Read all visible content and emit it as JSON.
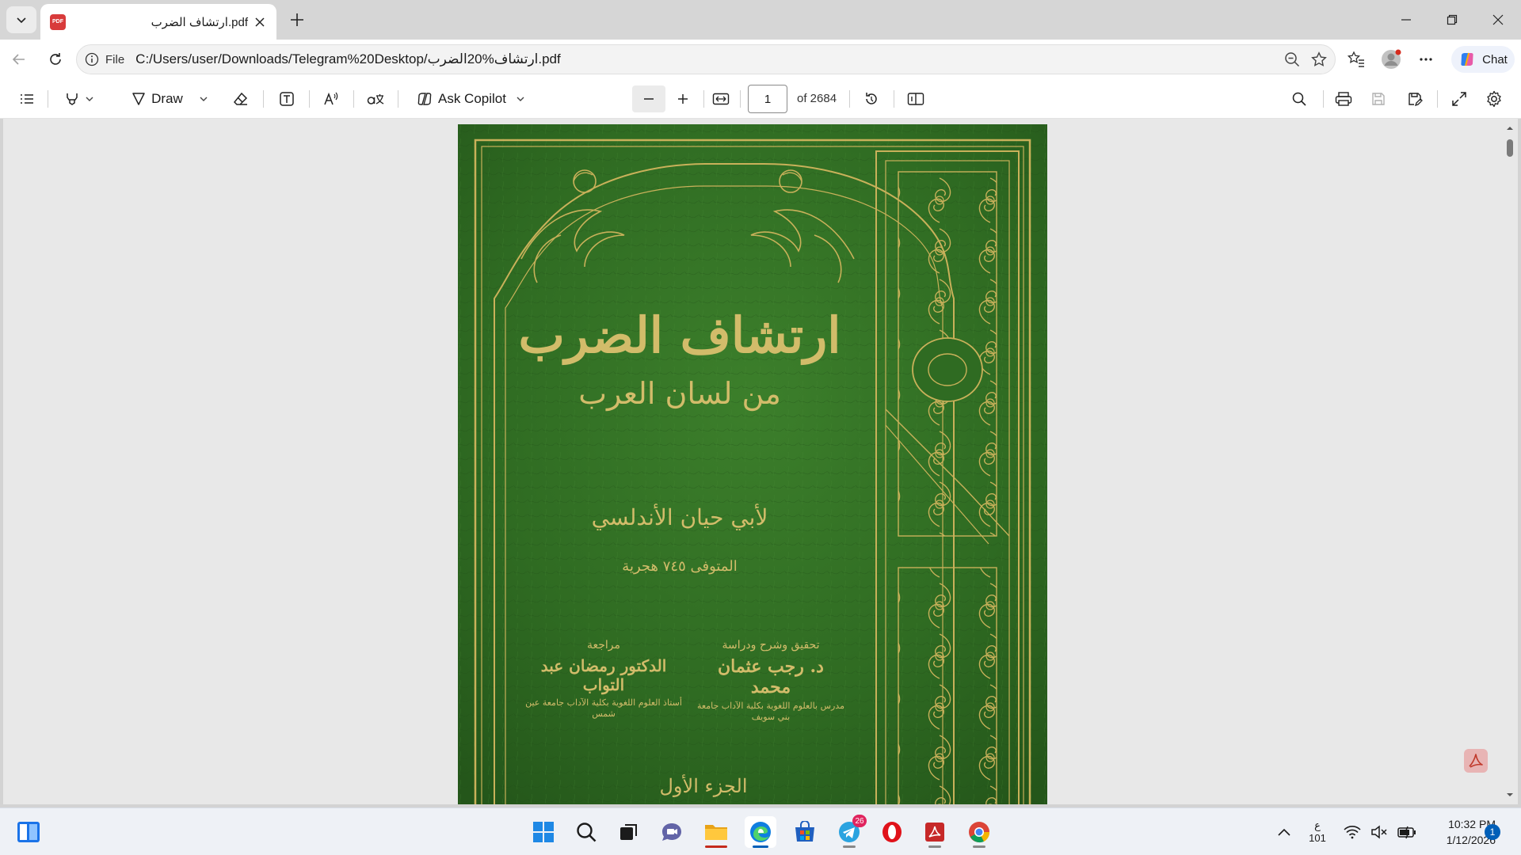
{
  "tab": {
    "title": "ارتشاف الضرب.pdf",
    "favicon_label": "PDF"
  },
  "address": {
    "site_label": "File",
    "url": "C:/Users/user/Downloads/Telegram%20Desktop/ارتشاف%20الضرب.pdf"
  },
  "chat": {
    "label": "Chat"
  },
  "toolbar": {
    "draw_label": "Draw",
    "copilot_label": "Ask Copilot",
    "page_current": "1",
    "page_total": "of 2684"
  },
  "book": {
    "title": "ارتشاف الضرب",
    "subtitle": "من لسان العرب",
    "author": "لأبي حيان الأندلسي",
    "died": "المتوفى ٧٤٥ هجرية",
    "editor_heading": "تحقيق وشرح ودراسة",
    "editor_name": "د. رجب عثمان محمد",
    "editor_note": "مدرس بالعلوم اللغوية بكلية الآداب جامعة بني سويف",
    "reviewer_heading": "مراجعة",
    "reviewer_name": "الدكتور رمضان عبد التواب",
    "reviewer_note": "أستاذ العلوم اللغوية بكلية الآداب جامعة عين شمس",
    "volume": "الجزء الأول"
  },
  "tray": {
    "keyboard_lang": "ع",
    "keyboard_code": "101",
    "time": "10:32 PM",
    "date": "1/12/2026",
    "notifications": "1",
    "telegram_badge": "26"
  },
  "colors": {
    "cover_green": "#2f6b22",
    "gold": "#c9b15a",
    "accent": "#005fb8"
  }
}
